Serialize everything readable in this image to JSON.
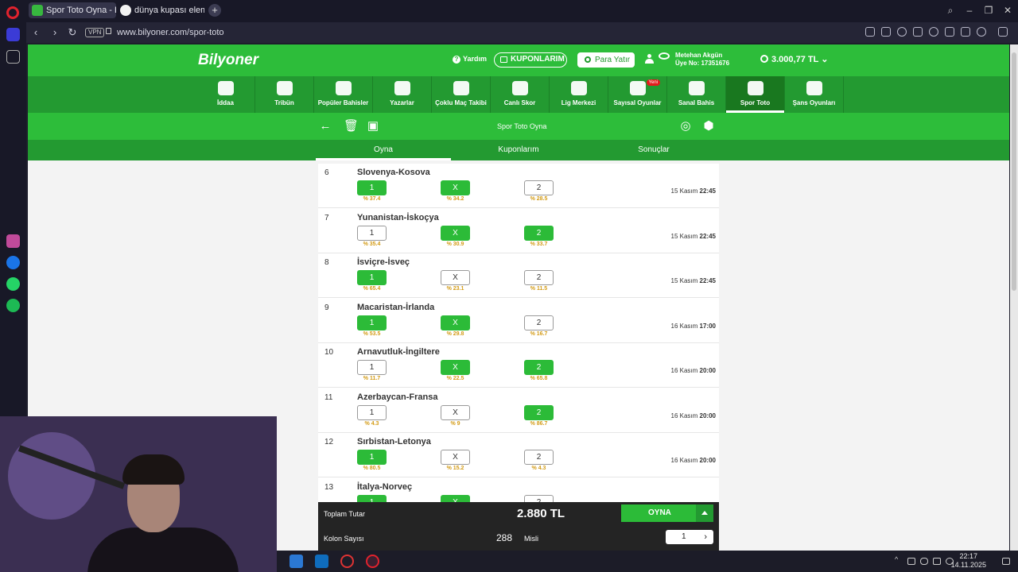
{
  "browser": {
    "tabs": [
      {
        "label": "Spor Toto Oyna - Bilyoner"
      },
      {
        "label": "dünya kupası elemeleri pu"
      }
    ],
    "new_tab_label": "+",
    "vpn_label": "VPN",
    "url": "www.bilyoner.com/spor-toto"
  },
  "site": {
    "logo": "Bilyoner",
    "help_label": "Yardım",
    "kuponlarim_label": "KUPONLARIM",
    "para_yatir_label": "Para Yatır",
    "user_name": "Metehan Akgün",
    "user_no": "Üye No: 17351676",
    "balance": "3.000,77 TL",
    "categories": [
      {
        "label": "İddaa",
        "icon": "iddaa-icon"
      },
      {
        "label": "Tribün",
        "icon": "tribun-icon"
      },
      {
        "label": "Popüler Bahisler",
        "icon": "flame-icon"
      },
      {
        "label": "Yazarlar",
        "icon": "chat-icon"
      },
      {
        "label": "Çoklu Maç Takibi",
        "icon": "grid-icon"
      },
      {
        "label": "Canlı Skor",
        "icon": "score-icon"
      },
      {
        "label": "Lig Merkezi",
        "icon": "bars-icon"
      },
      {
        "label": "Sayısal Oyunlar",
        "icon": "shield-icon",
        "badge": "Yeni"
      },
      {
        "label": "Sanal Bahis",
        "icon": "runner-icon"
      },
      {
        "label": "Spor Toto",
        "icon": "spor-toto-icon"
      },
      {
        "label": "Şans Oyunları",
        "icon": "clover-icon"
      }
    ],
    "action_title": "Spor Toto Oyna",
    "subtabs": [
      "Oyna",
      "Kuponlarım",
      "Sonuçlar"
    ]
  },
  "matches": [
    {
      "no": "6",
      "name": "Slovenya-Kosova",
      "options": [
        {
          "label": "1",
          "pct": "% 37.4",
          "selected": true
        },
        {
          "label": "X",
          "pct": "% 34.2",
          "selected": true
        },
        {
          "label": "2",
          "pct": "% 28.5",
          "selected": false
        }
      ],
      "date": "15 Kasım",
      "time": "22:45"
    },
    {
      "no": "7",
      "name": "Yunanistan-İskoçya",
      "options": [
        {
          "label": "1",
          "pct": "% 35.4",
          "selected": false
        },
        {
          "label": "X",
          "pct": "% 30.9",
          "selected": true
        },
        {
          "label": "2",
          "pct": "% 33.7",
          "selected": true
        }
      ],
      "date": "15 Kasım",
      "time": "22:45"
    },
    {
      "no": "8",
      "name": "İsviçre-İsveç",
      "options": [
        {
          "label": "1",
          "pct": "% 65.4",
          "selected": true
        },
        {
          "label": "X",
          "pct": "% 23.1",
          "selected": false
        },
        {
          "label": "2",
          "pct": "% 11.5",
          "selected": false
        }
      ],
      "date": "15 Kasım",
      "time": "22:45"
    },
    {
      "no": "9",
      "name": "Macaristan-İrlanda",
      "options": [
        {
          "label": "1",
          "pct": "% 53.5",
          "selected": true
        },
        {
          "label": "X",
          "pct": "% 29.8",
          "selected": true
        },
        {
          "label": "2",
          "pct": "% 16.7",
          "selected": false
        }
      ],
      "date": "16 Kasım",
      "time": "17:00"
    },
    {
      "no": "10",
      "name": "Arnavutluk-İngiltere",
      "options": [
        {
          "label": "1",
          "pct": "% 11.7",
          "selected": false
        },
        {
          "label": "X",
          "pct": "% 22.5",
          "selected": true
        },
        {
          "label": "2",
          "pct": "% 65.8",
          "selected": true
        }
      ],
      "date": "16 Kasım",
      "time": "20:00"
    },
    {
      "no": "11",
      "name": "Azerbaycan-Fransa",
      "options": [
        {
          "label": "1",
          "pct": "% 4.3",
          "selected": false
        },
        {
          "label": "X",
          "pct": "% 9",
          "selected": false
        },
        {
          "label": "2",
          "pct": "% 86.7",
          "selected": true
        }
      ],
      "date": "16 Kasım",
      "time": "20:00"
    },
    {
      "no": "12",
      "name": "Sırbistan-Letonya",
      "options": [
        {
          "label": "1",
          "pct": "% 80.5",
          "selected": true
        },
        {
          "label": "X",
          "pct": "% 15.2",
          "selected": false
        },
        {
          "label": "2",
          "pct": "% 4.3",
          "selected": false
        }
      ],
      "date": "16 Kasım",
      "time": "20:00"
    },
    {
      "no": "13",
      "name": "İtalya-Norveç",
      "options": [
        {
          "label": "1",
          "pct": "",
          "selected": true
        },
        {
          "label": "X",
          "pct": "",
          "selected": true
        },
        {
          "label": "2",
          "pct": "",
          "selected": false
        }
      ],
      "date": "",
      "time": ""
    }
  ],
  "summary": {
    "toplam_label": "Toplam Tutar",
    "toplam_value": "2.880 TL",
    "oyna_label": "OYNA",
    "kolon_label": "Kolon Sayısı",
    "kolon_value": "288",
    "misli_label": "Misli",
    "misli_value": "1"
  },
  "taskbar": {
    "time": "22:17",
    "date": "14.11.2025"
  },
  "colors": {
    "brand_green": "#2dbd3a",
    "dark_green": "#239a31",
    "selected_green": "#2cbb38",
    "percent_orange": "#d39b16"
  }
}
